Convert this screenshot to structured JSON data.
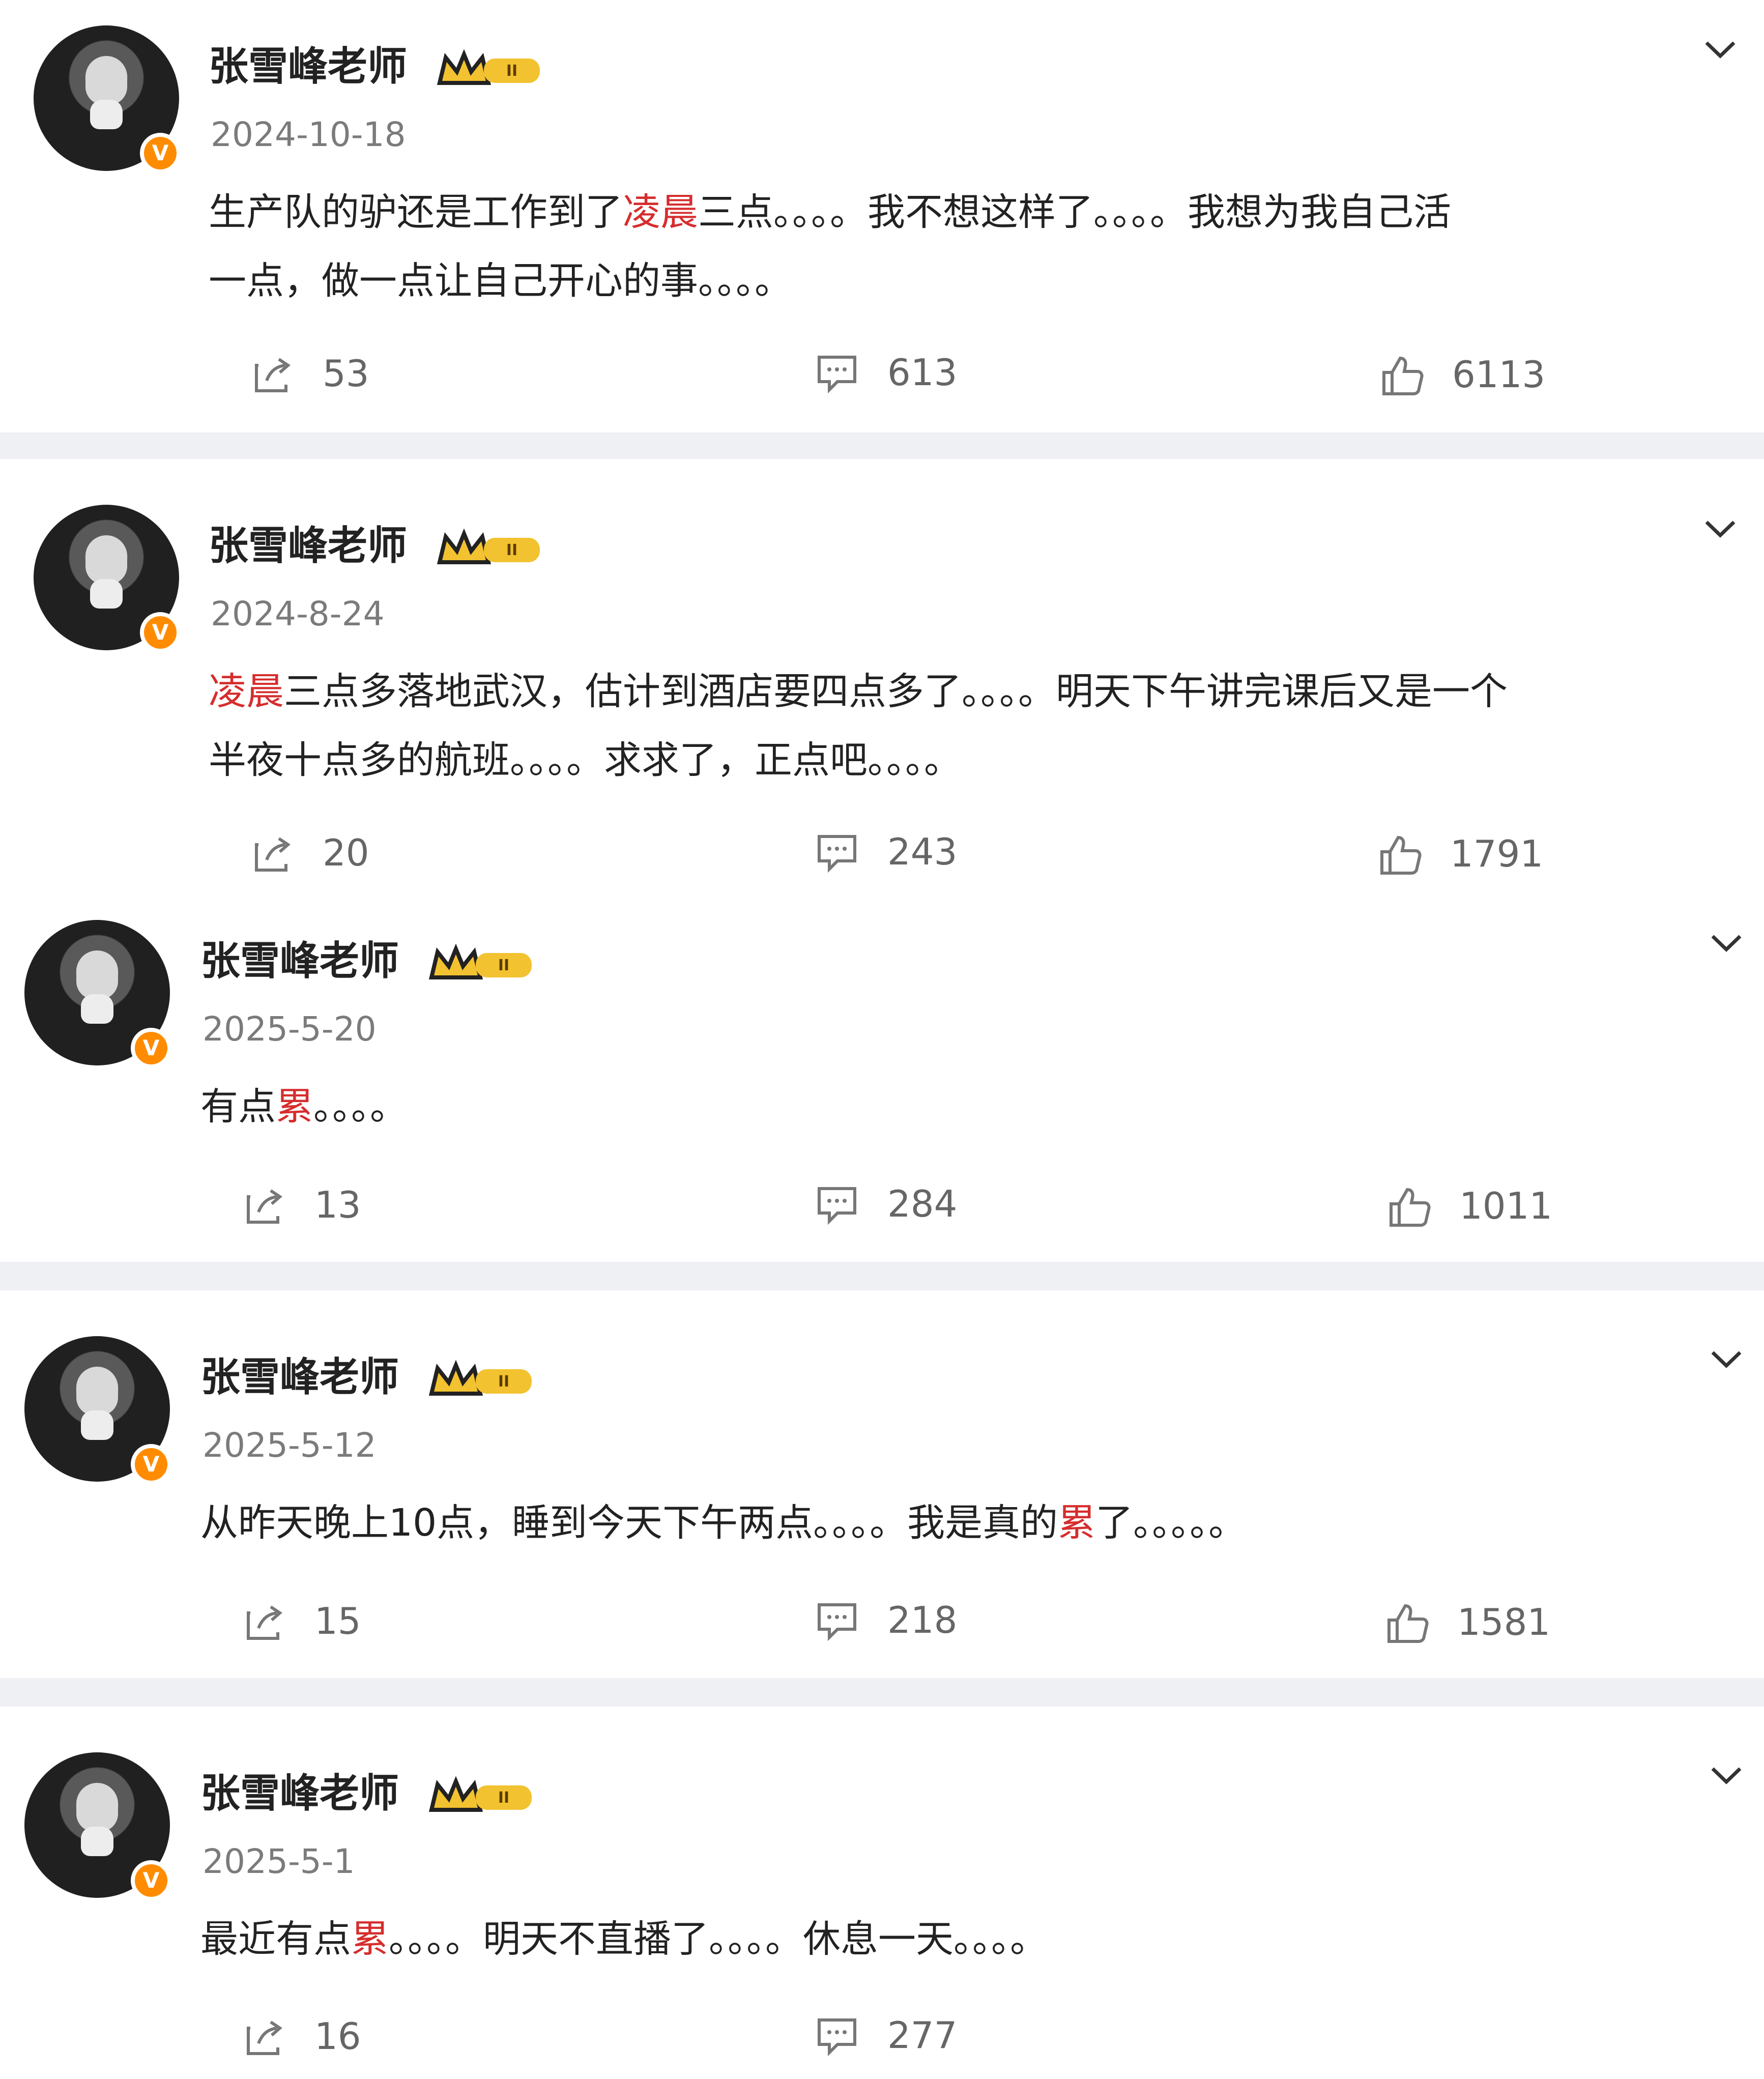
{
  "feed": {
    "posts": [
      {
        "user": "张雪峰老师",
        "date": "2024-10-18",
        "content_lines": [
          [
            {
              "text": "生产队的驴还是工作到了",
              "accent": false
            },
            {
              "text": "凌晨",
              "accent": true
            },
            {
              "text": "三点。。。。我不想这样了。。。。我想为我自己活",
              "accent": false
            }
          ],
          [
            {
              "text": "一点，做一点让自己开心的事。。。。",
              "accent": false
            }
          ]
        ],
        "shares": "53",
        "comments": "613",
        "likes": "6113"
      },
      {
        "user": "张雪峰老师",
        "date": "2024-8-24",
        "content_lines": [
          [
            {
              "text": "凌晨",
              "accent": true
            },
            {
              "text": "三点多落地武汉，估计到酒店要四点多了。。。。明天下午讲完课后又是一个",
              "accent": false
            }
          ],
          [
            {
              "text": "半夜十点多的航班。。。。求求了，正点吧。。。。",
              "accent": false
            }
          ]
        ],
        "shares": "20",
        "comments": "243",
        "likes": "1791"
      },
      {
        "user": "张雪峰老师",
        "date": "2025-5-20",
        "content_lines": [
          [
            {
              "text": "有点",
              "accent": false
            },
            {
              "text": "累",
              "accent": true
            },
            {
              "text": "。。。。",
              "accent": false
            }
          ]
        ],
        "shares": "13",
        "comments": "284",
        "likes": "1011"
      },
      {
        "user": "张雪峰老师",
        "date": "2025-5-12",
        "content_lines": [
          [
            {
              "text": "从昨天晚上10点，睡到今天下午两点。。。。我是真的",
              "accent": false
            },
            {
              "text": "累",
              "accent": true
            },
            {
              "text": "了。。。。。",
              "accent": false
            }
          ]
        ],
        "shares": "15",
        "comments": "218",
        "likes": "1581"
      },
      {
        "user": "张雪峰老师",
        "date": "2025-5-1",
        "content_lines": [
          [
            {
              "text": "最近有点",
              "accent": false
            },
            {
              "text": "累",
              "accent": true
            },
            {
              "text": "。。。。明天不直播了。。。。休息一天。。。。",
              "accent": false
            }
          ]
        ],
        "shares": "16",
        "comments": "277",
        "likes": ""
      }
    ]
  },
  "icons": {
    "share": "share-icon",
    "comment": "comment-icon",
    "like": "thumb-up-icon",
    "dropdown": "chevron-down-icon",
    "verified": "verified-badge-icon",
    "rank": "crown-rank-badge-icon"
  },
  "colors": {
    "accent": "#d62d2d",
    "verified": "#ff8c00",
    "rank_gold": "#f2c230",
    "username": "#222222",
    "meta": "#7b7b7b",
    "separator": "#eef0f3"
  },
  "badges": {
    "verified_mark": "V",
    "rank_mark": "II"
  }
}
